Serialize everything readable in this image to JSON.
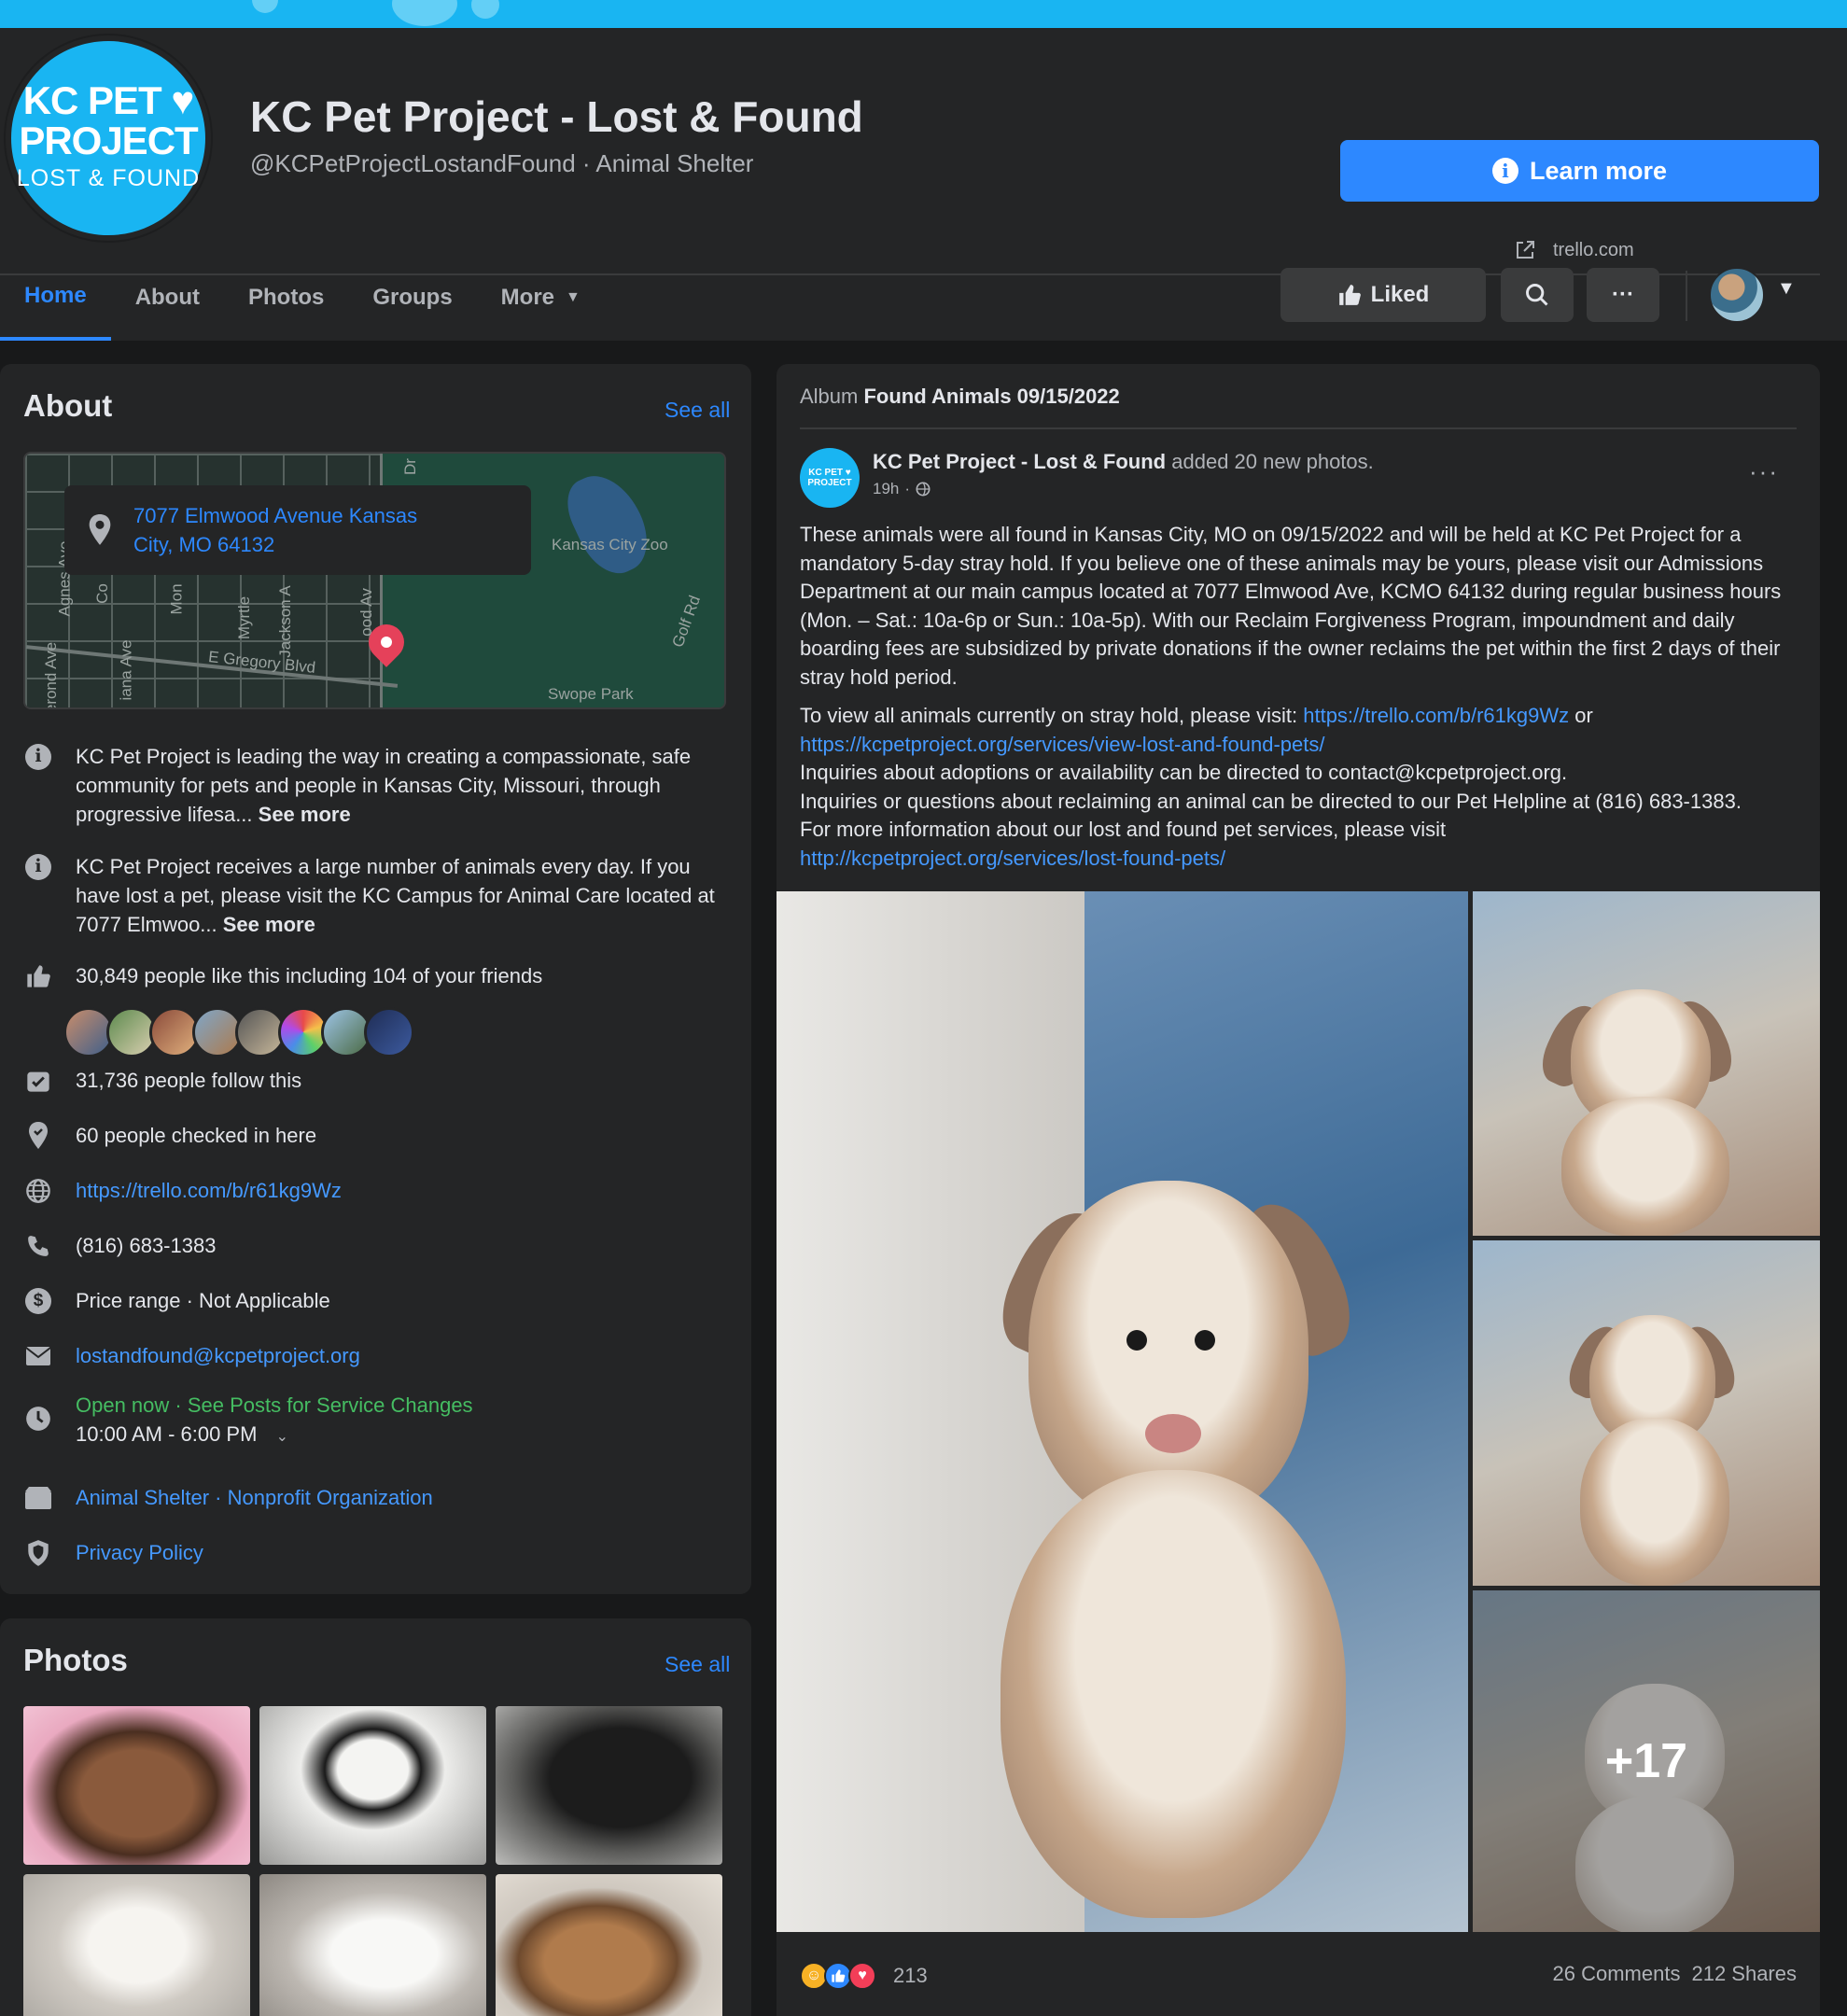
{
  "page": {
    "logo": {
      "line1": "KC PET ♥",
      "line2": "PROJECT",
      "line3": "LOST & FOUND"
    },
    "title": "KC Pet Project - Lost & Found",
    "handle": "@KCPetProjectLostandFound · Animal Shelter",
    "cta_label": "Learn more",
    "cta_domain": "trello.com",
    "accent": "#2d88ff"
  },
  "tabs": [
    {
      "label": "Home",
      "active": true
    },
    {
      "label": "About"
    },
    {
      "label": "Photos"
    },
    {
      "label": "Groups"
    },
    {
      "label": "More"
    }
  ],
  "actions": {
    "liked_label": "Liked",
    "search_icon": "search-icon",
    "more_icon": "ellipsis-icon"
  },
  "about": {
    "title": "About",
    "see_all": "See all",
    "map": {
      "address": "7077 Elmwood Avenue Kansas City, MO 64132",
      "labels": [
        "Kansas City Zoo",
        "E Gregory Blvd",
        "Swope Park",
        "Agnes Ave",
        "Myrtle",
        "Jackson A",
        "Mon",
        "Co",
        "ood Av",
        "Golf Rd",
        "iana Ave",
        "erond Ave",
        "Dr"
      ]
    },
    "desc1_text": "KC Pet Project is leading the way in creating a compassionate, safe community for pets and people in Kansas City, Missouri, through progressive lifesa... ",
    "desc2_text": "KC Pet Project receives a large number of animals every day. If you have lost a pet, please visit the KC Campus for Animal Care located at 7077 Elmwoo... ",
    "see_more": "See more",
    "likes": "30,849 people like this including 104 of your friends",
    "follows": "31,736 people follow this",
    "checkins": "60 people checked in here",
    "website": "https://trello.com/b/r61kg9Wz",
    "phone": "(816) 683-1383",
    "price": "Price range · Not Applicable",
    "email": "lostandfound@kcpetproject.org",
    "hours_status": "Open now · See Posts for Service Changes",
    "hours": "10:00 AM - 6:00 PM",
    "category": "Animal Shelter · Nonprofit Organization",
    "privacy": "Privacy Policy"
  },
  "photos_section": {
    "title": "Photos",
    "see_all": "See all"
  },
  "post": {
    "album_prefix": "Album",
    "album_name": "Found Animals 09/15/2022",
    "author": "KC Pet Project - Lost & Found",
    "action": "added 20 new photos.",
    "time": "19h",
    "para1": "These animals were all found in Kansas City, MO on 09/15/2022 and will be held at KC Pet Project for a mandatory 5-day stray hold. If you believe one of these animals may be yours, please visit our Admissions Department at our main campus located at 7077 Elmwood Ave, KCMO 64132 during regular business hours (Mon. – Sat.: 10a-6p or Sun.: 10a-5p). With our Reclaim Forgiveness Program, impoundment and daily boarding fees are subsidized by private donations if the owner reclaims the pet within the first 2 days of their stray hold period.",
    "para2_prefix": "To view all animals currently on stray hold, please visit: ",
    "link1": "https://trello.com/b/r61kg9Wz",
    "or_text": " or",
    "link2": "https://kcpetproject.org/services/view-lost-and-found-pets/",
    "line3": "Inquiries about adoptions or availability can be directed to contact@kcpetproject.org.",
    "line4": "Inquiries or questions about reclaiming an animal can be directed to our Pet Helpline at (816) 683-1383.",
    "line5": "For more information about our lost and found pet services, please visit",
    "link3": "http://kcpetproject.org/services/lost-found-pets/",
    "more_photos": "+17",
    "reactions_count": "213",
    "comments": "26 Comments",
    "shares": "212 Shares"
  }
}
